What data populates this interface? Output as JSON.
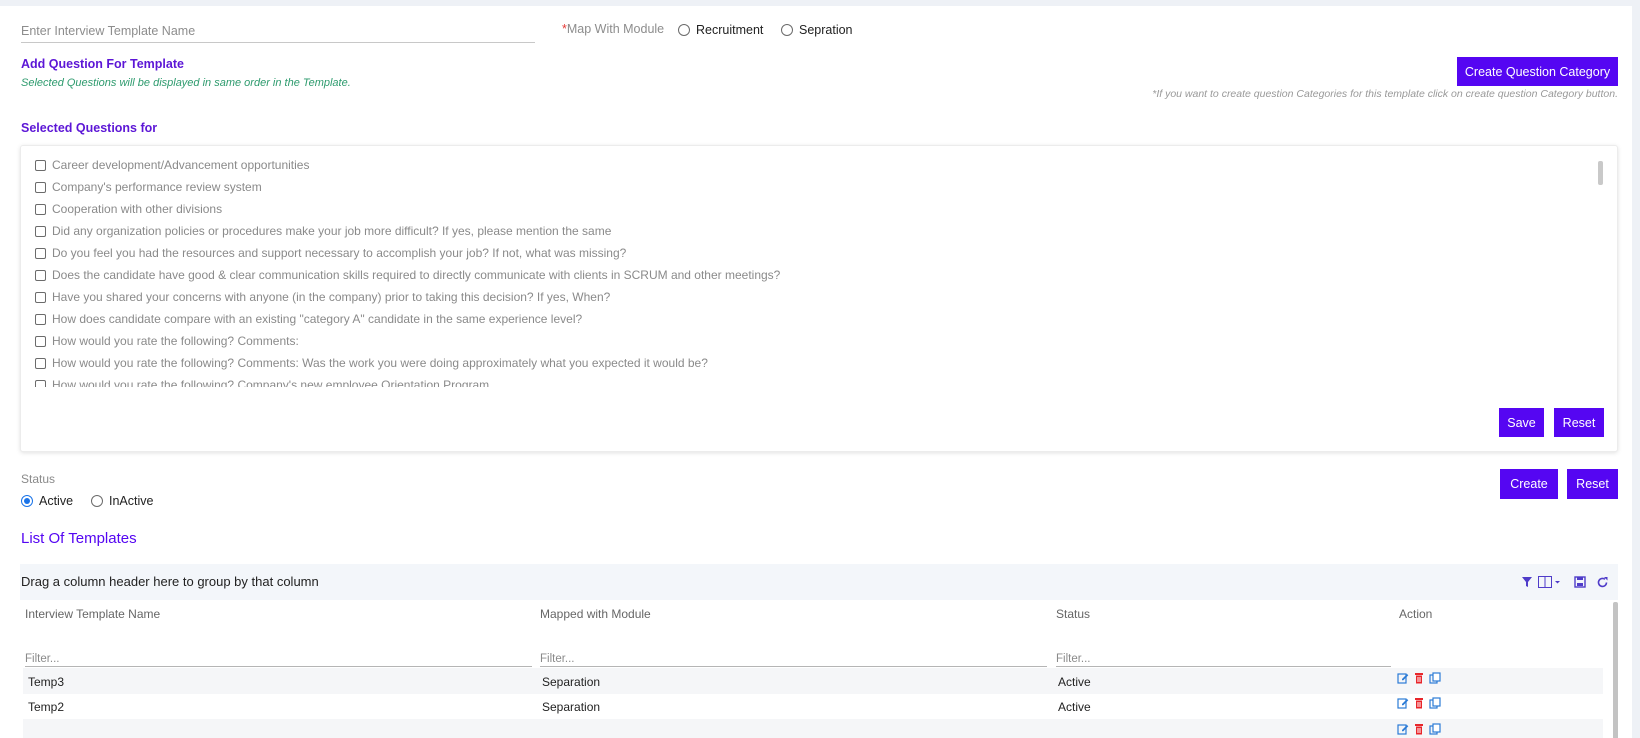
{
  "form": {
    "template_name_placeholder": "Enter Interview Template Name",
    "map_with_module_label": "Map With Module",
    "required_mark": "*",
    "module_options": [
      "Recruitment",
      "Sepration"
    ],
    "add_question_title": "Add Question For Template",
    "order_hint": "Selected Questions will be displayed in same order in the Template.",
    "create_category_button": "Create Question Category",
    "category_hint": "*If you want to create question Categories for this template click on create question Category button.",
    "selected_questions_title": "Selected Questions for"
  },
  "questions": [
    "Career development/Advancement opportunities",
    "Company's performance review system",
    "Cooperation with other divisions",
    "Did any organization policies or procedures make your job more difficult? If yes, please mention the same",
    "Do you feel you had the resources and support necessary to accomplish your job? If not, what was missing?",
    "Does the candidate have good & clear communication skills required to directly communicate with clients in SCRUM and other meetings?",
    "Have you shared your concerns with anyone (in the company) prior to taking this decision? If yes, When?",
    "How does candidate compare with an existing \"category A\" candidate in the same experience level?",
    "How would you rate the following? Comments:",
    "How would you rate the following? Comments: Was the work you were doing approximately what you expected it would be?",
    "How would you rate the following? Company's new employee Orientation Program"
  ],
  "question_box": {
    "save_button": "Save",
    "reset_button": "Reset"
  },
  "status": {
    "label": "Status",
    "options": [
      "Active",
      "InActive"
    ],
    "selected": "Active",
    "create_button": "Create",
    "reset_button": "Reset"
  },
  "templates": {
    "title": "List Of Templates",
    "group_hint": "Drag a column header here to group by that column",
    "columns": [
      "Interview Template Name",
      "Mapped with Module",
      "Status",
      "Action"
    ],
    "filter_placeholder": "Filter...",
    "rows": [
      {
        "name": "Temp3",
        "module": "Separation",
        "status": "Active"
      },
      {
        "name": "Temp2",
        "module": "Separation",
        "status": "Active"
      }
    ],
    "toolbar_icons": [
      "filter-icon",
      "columns-icon",
      "save-icon",
      "refresh-icon"
    ],
    "row_action_icons": [
      "edit-icon",
      "delete-icon",
      "copy-icon"
    ]
  },
  "colors": {
    "accent": "#5506f2",
    "title_purple": "#5c16d6",
    "hint_green": "#2e9b6e",
    "delete_red": "#e8262b"
  }
}
